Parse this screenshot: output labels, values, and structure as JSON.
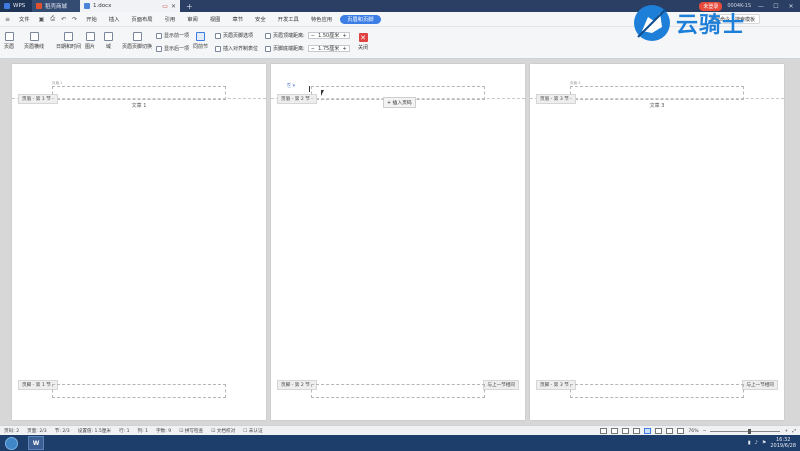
{
  "titlebar": {
    "tabs": [
      {
        "label": "WPS"
      },
      {
        "label": "稻壳商城"
      },
      {
        "label": "1.docx"
      }
    ],
    "add_tab": "+",
    "unlogged_label": "未登录",
    "user_id": "0004K-1S"
  },
  "menubar": {
    "file_label": "文件",
    "items": [
      "开始",
      "插入",
      "页面布局",
      "引用",
      "审阅",
      "视图",
      "章节",
      "安全",
      "开发工具",
      "特色应用",
      "页眉和页脚"
    ],
    "active_item": "页眉和页脚",
    "search_label": "查找命令、搜索模板"
  },
  "ribbon": {
    "header": "页眉",
    "footer": "页眉横线",
    "date_time": "日期和时间",
    "picture": "图片",
    "field": "域",
    "switch_hf": "页眉页脚切换",
    "show_prev": "显示前一项",
    "show_next": "显示后一项",
    "same_prev": "同前节",
    "hf_options": "页眉页脚选项",
    "insert_align_tab": "插入对齐制表位",
    "header_top_label": "页眉顶端距离:",
    "header_top_value": "1.50厘米",
    "footer_bottom_label": "页脚底端距离:",
    "footer_bottom_value": "1.75厘米",
    "close_label": "关闭"
  },
  "pages": [
    {
      "header_small": "页眉-1",
      "section_header": "页眉 - 第 1 节 -",
      "header_text": "文章 1",
      "section_footer": "页脚 - 第 1 节 -",
      "same_prev": ""
    },
    {
      "header_small": "",
      "section_header": "页眉 - 第 2 节 -",
      "header_text": "",
      "section_footer": "页脚 - 第 2 节 -",
      "same_prev": "与上一节相同"
    },
    {
      "header_small": "页眉-3",
      "section_header": "页眉 - 第 3 节 -",
      "header_text": "文章 3",
      "section_footer": "页脚 - 第 3 节 -",
      "same_prev": "与上一节相同"
    }
  ],
  "insert_page_number": "+ 插入页码",
  "logo_text": "云骑士",
  "statusbar": {
    "page_num": "页码: 2",
    "pages": "页面: 2/3",
    "section": "节: 2/3",
    "set_value": "设置值: 1.5厘米",
    "row": "行: 1",
    "col": "列: 1",
    "word_count": "字数: 9",
    "spell_check": "拼写检查",
    "doc_proof": "文档校对",
    "uncertified": "未认证",
    "zoom": "76%",
    "zoom_fraction": 0.55
  },
  "taskbar": {
    "wps_label": "W",
    "time": "16:32",
    "date": "2019/6/28"
  }
}
